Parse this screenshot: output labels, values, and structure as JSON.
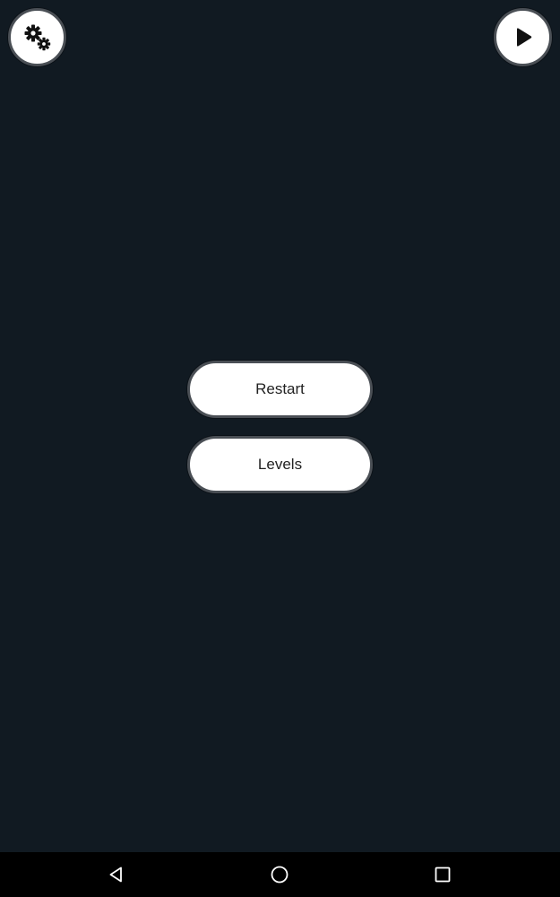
{
  "top_controls": {
    "settings_icon": "gears-icon",
    "play_icon": "play-icon"
  },
  "menu": {
    "restart_label": "Restart",
    "levels_label": "Levels"
  },
  "navbar": {
    "back_icon": "triangle-back-icon",
    "home_icon": "circle-home-icon",
    "recents_icon": "square-recents-icon"
  },
  "colors": {
    "background": "#111a22",
    "button_fill": "#ffffff",
    "button_border": "#4a4f55",
    "navbar": "#000000"
  }
}
